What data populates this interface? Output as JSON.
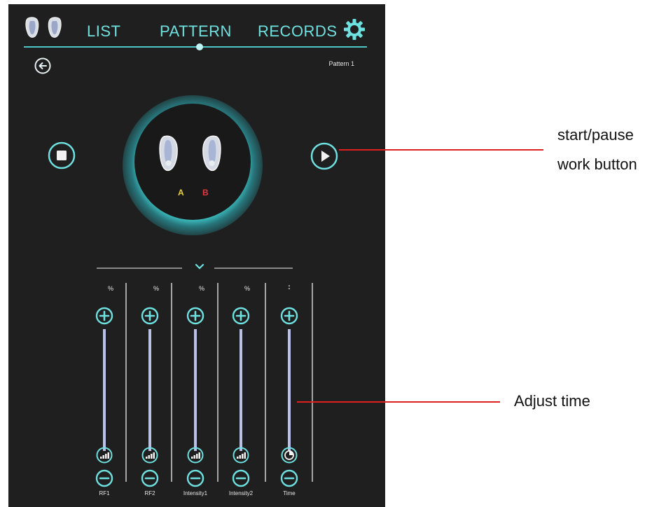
{
  "nav": {
    "tabs": [
      "LIST",
      "PATTERN",
      "RECORDS"
    ],
    "active_tab": "PATTERN",
    "settings_icon": "gear-icon",
    "logo_icon": "electrode-pads-icon",
    "accent_color": "#6fe0e0"
  },
  "header": {
    "back_icon": "back-arrow-icon",
    "pattern_name": "Pattern 1"
  },
  "device": {
    "pads_icon": "electrode-pads-icon",
    "channel_a": "A",
    "channel_b": "B",
    "channel_a_color": "#e8d140",
    "channel_b_color": "#e23b3b",
    "stop_icon": "stop-icon",
    "play_icon": "play-icon"
  },
  "controls": {
    "columns": [
      {
        "label": "RF1",
        "unit": "%",
        "level_icon": "signal-strength-icon"
      },
      {
        "label": "RF2",
        "unit": "%",
        "level_icon": "signal-strength-icon"
      },
      {
        "label": "Intensity1",
        "unit": "%",
        "level_icon": "signal-strength-icon"
      },
      {
        "label": "Intensity2",
        "unit": "%",
        "level_icon": "signal-strength-icon"
      },
      {
        "label": "Time",
        "unit": ":",
        "level_icon": "clock-icon"
      }
    ]
  },
  "annotations": {
    "start_pause_line1": "start/pause",
    "start_pause_line2": "work button",
    "adjust_time": "Adjust time",
    "arrow_color": "#e02020"
  }
}
